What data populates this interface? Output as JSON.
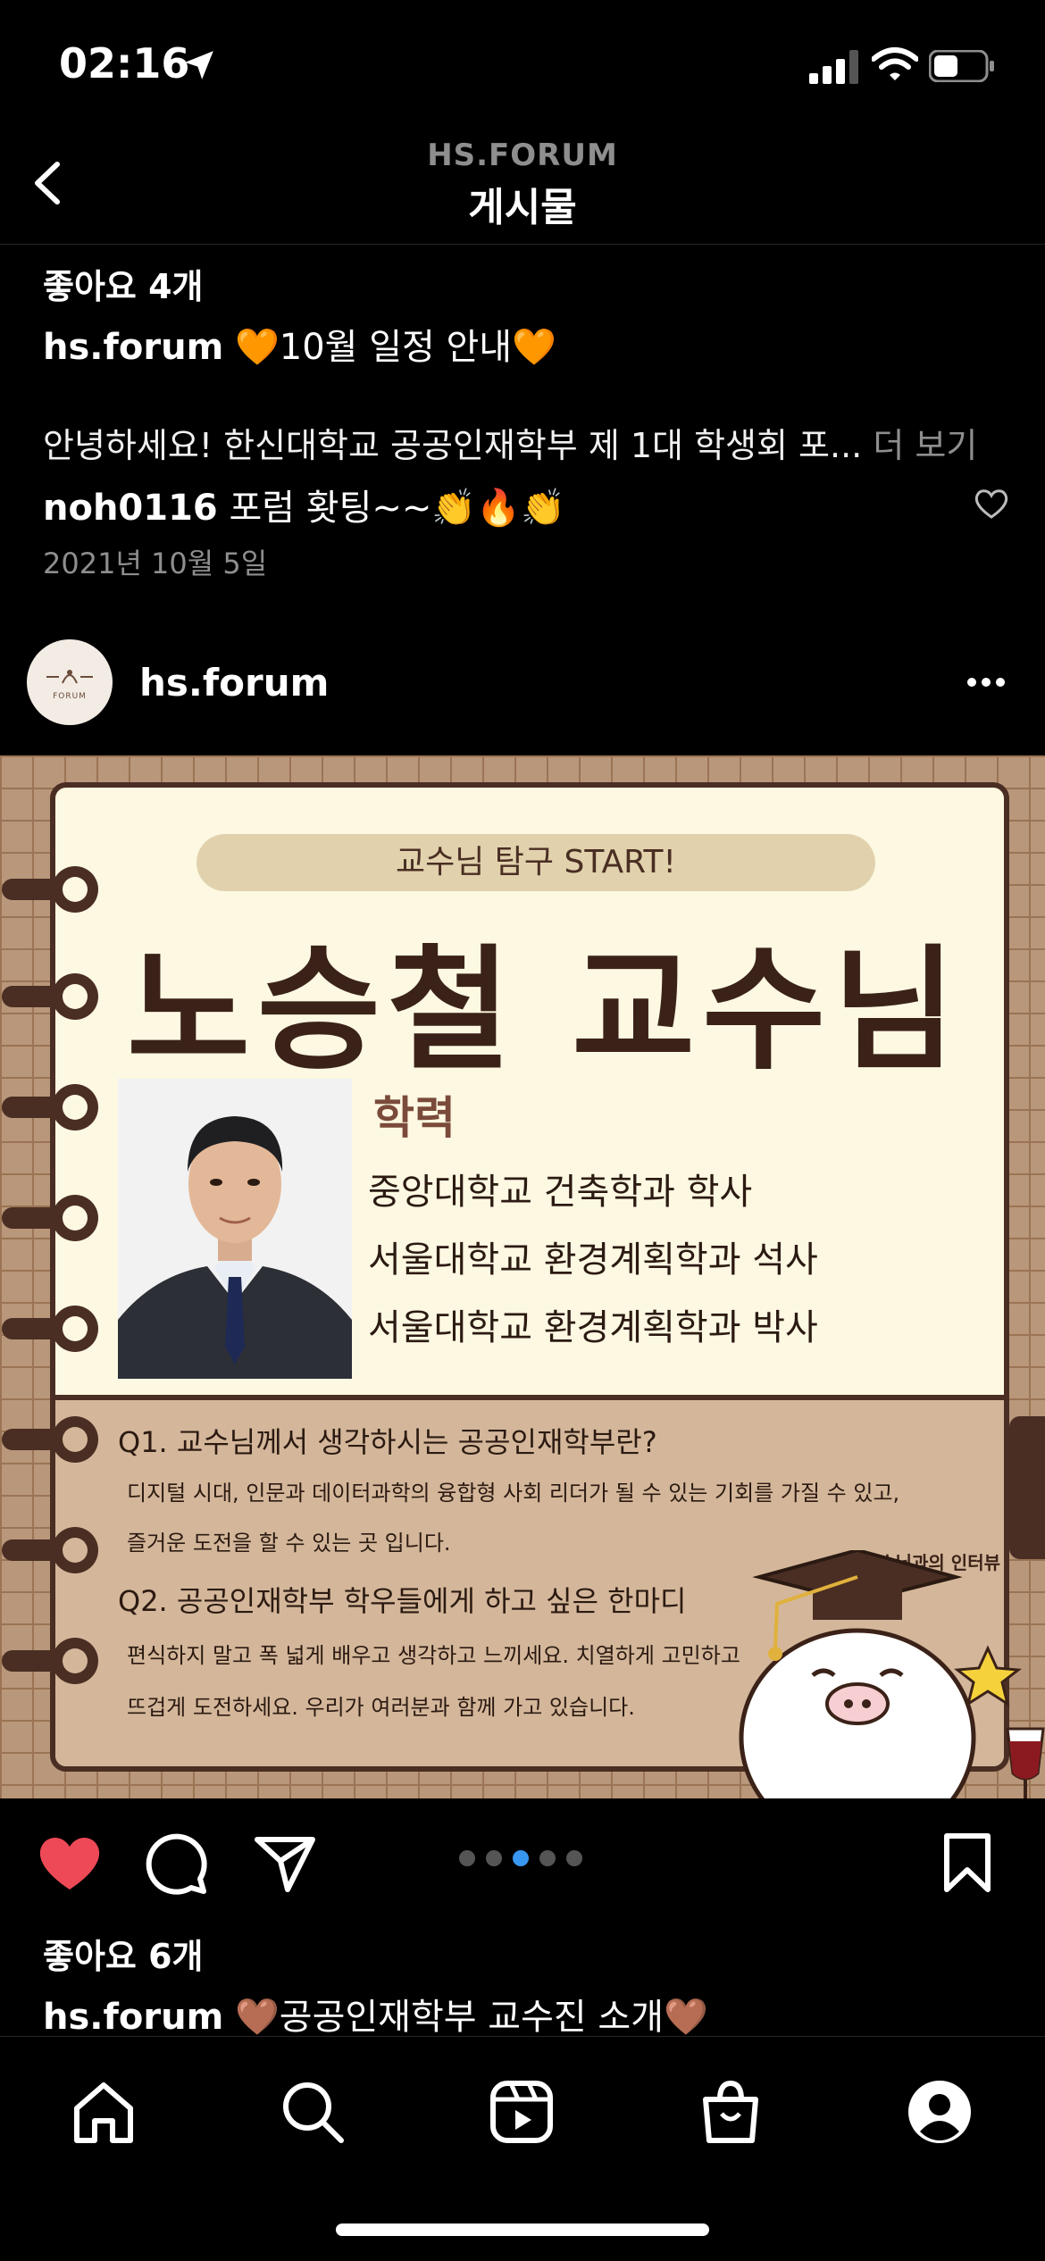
{
  "status_bar": {
    "time": "02:16"
  },
  "header": {
    "account": "HS.FORUM",
    "title": "게시물"
  },
  "prev_post": {
    "likes": "좋아요 4개",
    "caption_user": "hs.forum",
    "caption_text": "10월 일정 안내",
    "caption_heart": "🧡",
    "body": "안녕하세요! 한신대학교 공공인재학부 제 1대 학생회 포...",
    "more_label": "더 보기",
    "comment_user": "noh0116",
    "comment_text": "포럼 홧팅~~👏🔥👏",
    "date": "2021년 10월 5일"
  },
  "post": {
    "username": "hs.forum",
    "avatar_logo_text": "FORUM",
    "image": {
      "pill": "교수님 탐구 START!",
      "title": "노승철 교수님",
      "edu_label": "학력",
      "edu_items": [
        "중앙대학교 건축학과 학사",
        "서울대학교 환경계획학과 석사",
        "서울대학교 환경계획학과 박사"
      ],
      "q1_title": "Q1. 교수님께서 생각하시는 공공인재학부란?",
      "q1_body": [
        "디지털 시대, 인문과 데이터과학의 융합형 사회 리더가 될 수 있는 기회를 가질 수 있고,",
        "즐거운 도전을 할 수 있는 곳 입니다."
      ],
      "q2_title": "Q2. 공공인재학부 학우들에게 하고 싶은 한마디",
      "q2_body": [
        "편식하지 말고 폭 넓게 배우고 생각하고 느끼세요.  치열하게 고민하고",
        "뜨겁게 도전하세요. 우리가 여러분과 함께 가고 있습니다."
      ],
      "tag": "교수님과의 인터뷰"
    },
    "carousel": {
      "count": 5,
      "active_index": 2
    },
    "likes": "좋아요 6개",
    "caption_user": "hs.forum",
    "caption_text": "공공인재학부 교수진 소개",
    "caption_heart": "🤎"
  },
  "colors": {
    "like_red": "#ed4956",
    "dot_active": "#3897f0",
    "brown_dark": "#3b2218"
  }
}
